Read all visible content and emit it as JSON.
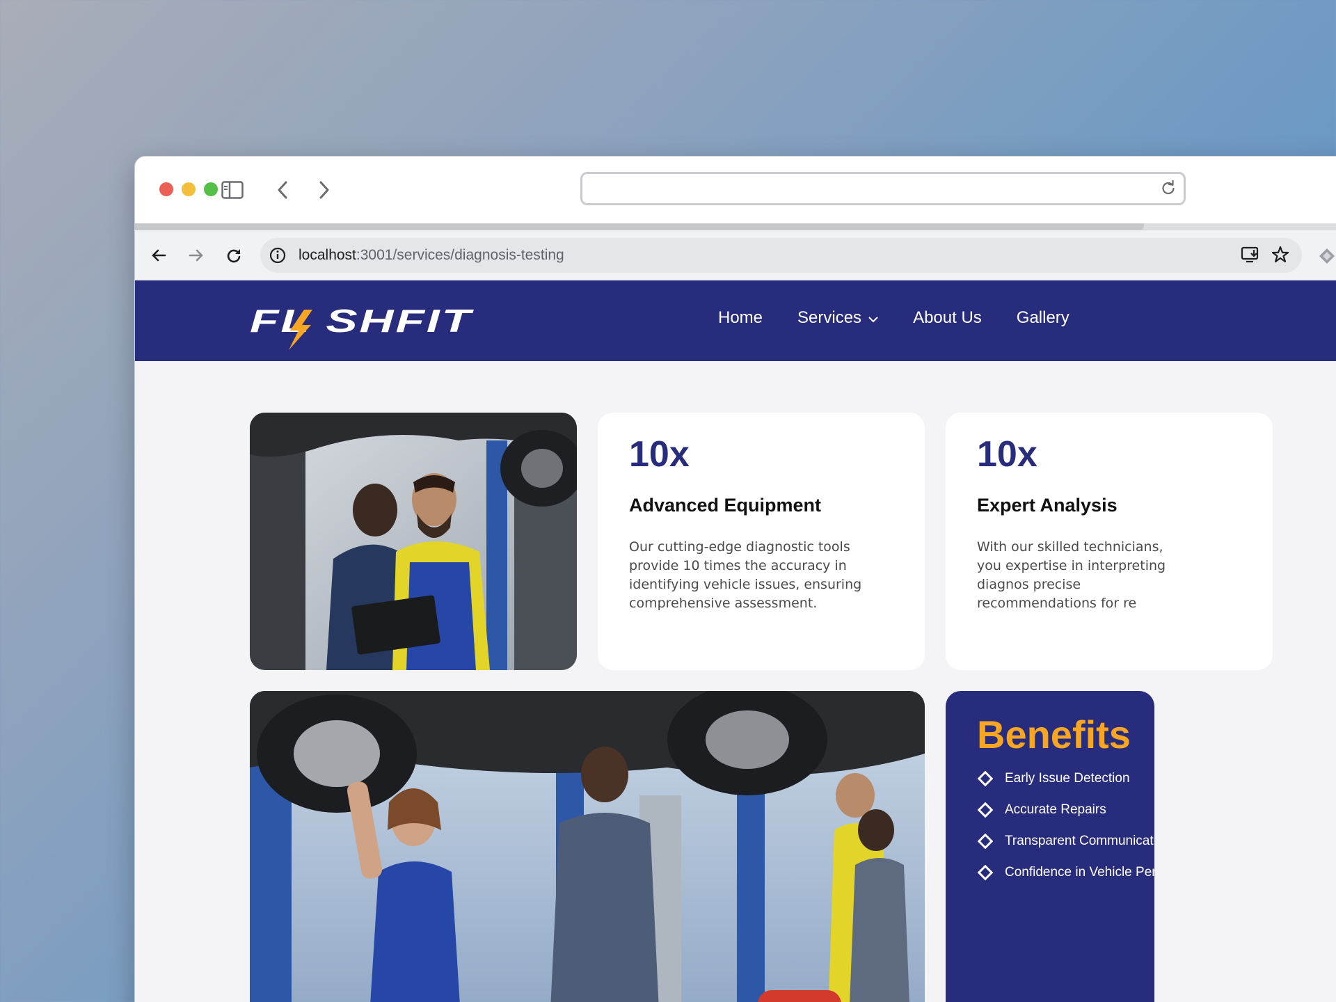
{
  "browser": {
    "url_host": "localhost",
    "url_path": ":3001/services/diagnosis-testing"
  },
  "nav": {
    "logo_text": "FLASHFIT",
    "links": [
      {
        "label": "Home"
      },
      {
        "label": "Services"
      },
      {
        "label": "About Us"
      },
      {
        "label": "Gallery"
      }
    ]
  },
  "stats": [
    {
      "value": "10x",
      "title": "Advanced Equipment",
      "description": "Our cutting-edge diagnostic tools provide 10 times the accuracy in identifying vehicle issues, ensuring comprehensive assessment."
    },
    {
      "value": "10x",
      "title": "Expert Analysis",
      "description": "With our skilled technicians, you expertise in interpreting diagnos precise recommendations for re"
    }
  ],
  "benefits": {
    "title": "Benefits",
    "items": [
      "Early Issue Detection",
      "Accurate Repairs",
      "Transparent Communication",
      "Confidence in Vehicle Performan"
    ]
  },
  "colors": {
    "nav_bg": "#272c7c",
    "accent": "#f6a623",
    "stat_value": "#272c7c"
  }
}
